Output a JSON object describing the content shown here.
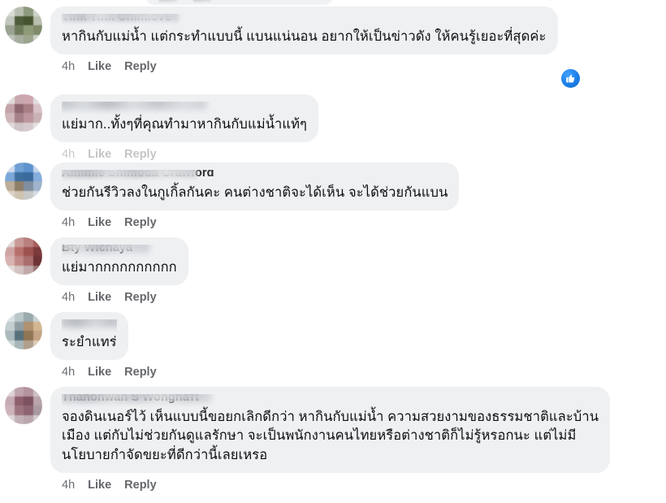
{
  "app": {
    "surface": "facebook-comment-thread",
    "background_color": "#ffffff",
    "bubble_color": "#eef0f2",
    "text_color": "#0d0d0e",
    "meta_color": "#65676b",
    "accent_color": "#1d7fe8"
  },
  "top_clipped_row": {
    "visible": true,
    "note": "partially cut-off comment bubble at very top edge"
  },
  "actions_labels": {
    "time": "4h",
    "like": "Like",
    "reply": "Reply"
  },
  "comments": [
    {
      "author": "Yink Yink Chimlove",
      "author_redacted": true,
      "text": "หากินกับแม่น้ำ แต่กระทำแบบนี้ แบนแน่นอน อยากให้เป็นข่าวดัง ให้คนรู้เยอะที่สุดค่ะ",
      "time": "4h",
      "like": "Like",
      "reply": "Reply",
      "reaction": "like-thumbs-up",
      "has_reaction": true,
      "avatar_tone": "olive-green"
    },
    {
      "author": "",
      "author_redacted": true,
      "text": "แย่มาก..ทั้งๆที่คุณทำมาหากินกับแม่น้ำแท้ๆ",
      "time": "4h",
      "like": "Like",
      "reply": "Reply",
      "has_reaction": false,
      "avatar_tone": "mauve-pink"
    },
    {
      "author": "Aimmie Shimoda Crawford",
      "author_redacted": true,
      "text": "ช่วยกันรีวิวลงในกูเกิ้ลกันคะ คนต่างชาติจะได้เห็น จะได้ช่วยกันแบน",
      "time": "4h",
      "like": "Like",
      "reply": "Reply",
      "has_reaction": false,
      "avatar_tone": "sky-blue"
    },
    {
      "author": "Bty Wichaya",
      "author_redacted": true,
      "text": "แย่มากกกกกกกกกก",
      "time": "4h",
      "like": "Like",
      "reply": "Reply",
      "has_reaction": false,
      "avatar_tone": "rose-red"
    },
    {
      "author": "",
      "author_redacted": true,
      "text": "ระยำแทร่",
      "time": "4h",
      "like": "Like",
      "reply": "Reply",
      "has_reaction": false,
      "avatar_tone": "steel-blue"
    },
    {
      "author": "Thanonwan S Wongnатt",
      "author_redacted": true,
      "text": "จองดินเนอร์ไว้ เห็นแบบนี้ขอยกเลิกดีกว่า หากินกับแม่น้ำ ความสวยงามของธรรมชาติและบ้าน\nเมือง แต่กับไม่ช่วยกันดูแลรักษา จะเป็นพนักงานคนไทยหรือต่างชาติก็ไม่รู้หรอกนะ แต่ไม่มี\nนโยบายกำจัดขยะที่ดีกว่านี้เลยเหรอ",
      "time": "4h",
      "like": "Like",
      "reply": "Reply",
      "has_reaction": false,
      "avatar_tone": "plum-mauve"
    }
  ]
}
